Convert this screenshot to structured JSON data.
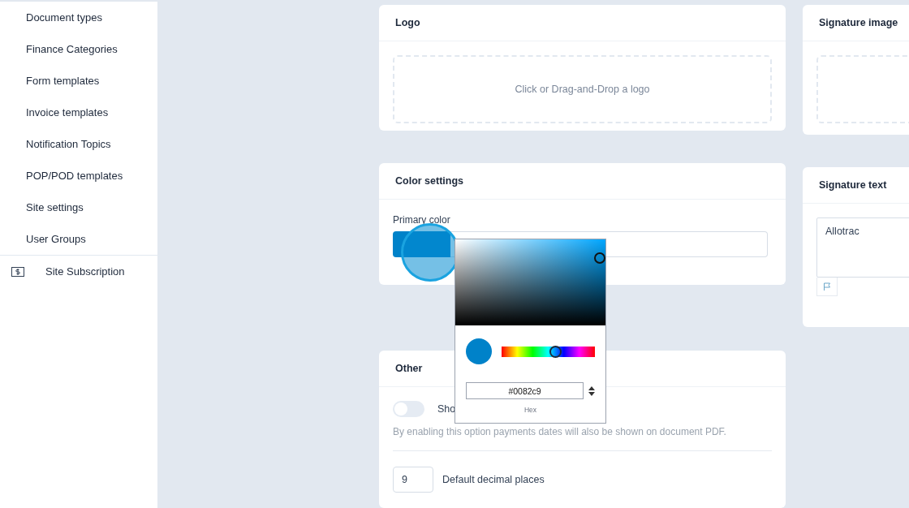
{
  "sidebar": {
    "items": [
      {
        "label": "Document types",
        "kind": "plain"
      },
      {
        "label": "Finance Categories",
        "kind": "plain"
      },
      {
        "label": "Form templates",
        "kind": "plain"
      },
      {
        "label": "Invoice templates",
        "kind": "plain"
      },
      {
        "label": "Notification Topics",
        "kind": "plain"
      },
      {
        "label": "POP/POD templates",
        "kind": "plain"
      },
      {
        "label": "Site settings",
        "kind": "plain"
      },
      {
        "label": "User Groups",
        "kind": "plain"
      },
      {
        "label": "Site Subscription",
        "kind": "icon"
      }
    ]
  },
  "logo_card": {
    "title": "Logo",
    "dropzone": "Click or Drag-and-Drop a logo"
  },
  "color_card": {
    "title": "Color settings",
    "label": "Primary color",
    "color": "#0082c9"
  },
  "other_card": {
    "title": "Other",
    "toggle": {
      "label": "Sho",
      "on": false
    },
    "hint": "By enabling this option payments dates will also be shown on document PDF.",
    "decimal": {
      "value": "9",
      "label": "Default decimal places"
    }
  },
  "signature_image_card": {
    "title": "Signature image"
  },
  "signature_text_card": {
    "title": "Signature text",
    "value": "Allotrac"
  },
  "color_picker": {
    "hex": "#0082c9",
    "hue": {
      "level": 0.57
    },
    "format": "Hex"
  }
}
